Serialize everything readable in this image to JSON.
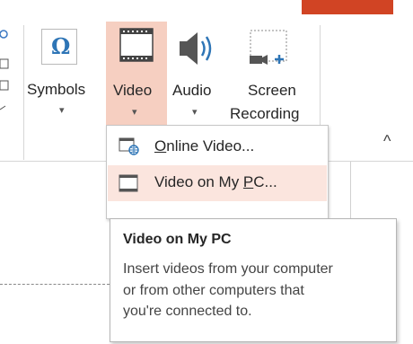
{
  "ribbon": {
    "symbols": {
      "label": "Symbols",
      "icon": "omega-icon",
      "caret": "▾"
    },
    "video": {
      "label": "Video",
      "icon": "film-icon",
      "caret": "▾",
      "state": "pressed"
    },
    "audio": {
      "label": "Audio",
      "icon": "speaker-icon",
      "caret": "▾"
    },
    "screen_recording": {
      "label_line1": "Screen",
      "label_line2": "Recording",
      "icon": "screen-record-icon"
    },
    "collapse": {
      "glyph": "^",
      "icon": "chevron-up-icon"
    }
  },
  "menu": {
    "items": [
      {
        "label": "Online Video...",
        "accelerator": "O",
        "icon": "online-video-icon"
      },
      {
        "label": "Video on My PC...",
        "accelerator": "P",
        "icon": "film-strip-icon",
        "highlighted": true
      }
    ]
  },
  "tooltip": {
    "title": "Video on My PC",
    "lines": [
      "Insert videos from your computer",
      "or from other computers that",
      "you're connected to."
    ]
  },
  "colors": {
    "accent": "#d14424",
    "pressed_bg": "#f6cfc1",
    "hover_bg": "#fbe5de",
    "omega_blue": "#2e75b6",
    "plus_blue": "#2e75b6"
  }
}
